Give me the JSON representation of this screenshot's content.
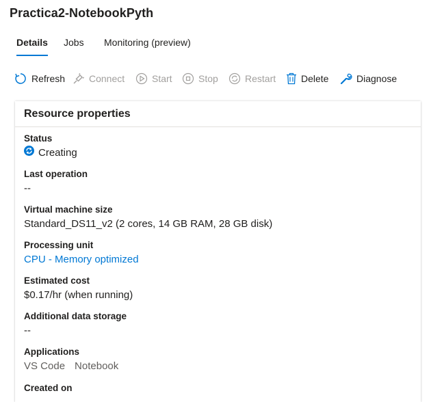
{
  "page": {
    "title": "Practica2-NotebookPyth"
  },
  "tabs": [
    {
      "label": "Details",
      "active": true
    },
    {
      "label": "Jobs",
      "active": false
    },
    {
      "label": "Monitoring (preview)",
      "active": false
    }
  ],
  "toolbar": {
    "refresh": "Refresh",
    "connect": "Connect",
    "start": "Start",
    "stop": "Stop",
    "restart": "Restart",
    "delete": "Delete",
    "diagnose": "Diagnose"
  },
  "colors": {
    "accent": "#0078d4",
    "disabled": "#a19f9d",
    "text": "#201f1e"
  },
  "resource": {
    "title": "Resource properties",
    "status_label": "Status",
    "status_value": "Creating",
    "status_icon": "sync-icon",
    "last_operation_label": "Last operation",
    "last_operation_value": "--",
    "vm_size_label": "Virtual machine size",
    "vm_size_value": "Standard_DS11_v2 (2 cores, 14 GB RAM, 28 GB disk)",
    "processing_unit_label": "Processing unit",
    "processing_unit_value": "CPU - Memory optimized",
    "estimated_cost_label": "Estimated cost",
    "estimated_cost_value": "$0.17/hr (when running)",
    "additional_storage_label": "Additional data storage",
    "additional_storage_value": "--",
    "applications_label": "Applications",
    "applications": [
      "VS Code",
      "Notebook"
    ],
    "created_on_label": "Created on"
  }
}
